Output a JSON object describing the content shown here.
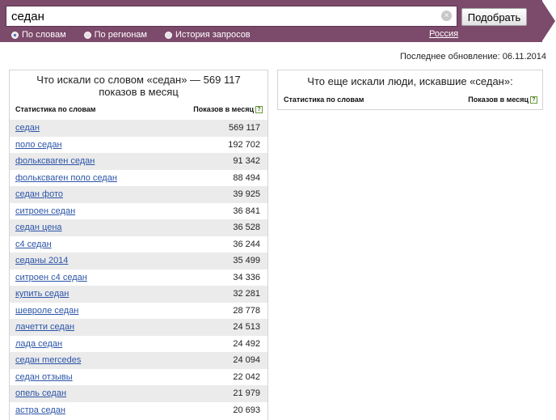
{
  "search": {
    "value": "седан",
    "button_label": "Подобрать"
  },
  "radios": [
    {
      "label": "По словам",
      "checked": true
    },
    {
      "label": "По регионам",
      "checked": false
    },
    {
      "label": "История запросов",
      "checked": false
    }
  ],
  "region": "Россия",
  "last_update": "Последнее обновление: 06.11.2014",
  "left_panel": {
    "title": "Что искали со словом «седан» — 569 117 показов в месяц",
    "col_stats": "Статистика по словам",
    "col_shows": "Показов в месяц",
    "help": "?",
    "rows": [
      {
        "keyword": "седан",
        "count": "569 117"
      },
      {
        "keyword": "поло седан",
        "count": "192 702"
      },
      {
        "keyword": "фольксваген седан",
        "count": "91 342"
      },
      {
        "keyword": "фольксваген поло седан",
        "count": "88 494"
      },
      {
        "keyword": "седан фото",
        "count": "39 925"
      },
      {
        "keyword": "ситроен седан",
        "count": "36 841"
      },
      {
        "keyword": "седан цена",
        "count": "36 528"
      },
      {
        "keyword": "с4 седан",
        "count": "36 244"
      },
      {
        "keyword": "седаны 2014",
        "count": "35 499"
      },
      {
        "keyword": "ситроен с4 седан",
        "count": "34 336"
      },
      {
        "keyword": "купить седан",
        "count": "32 281"
      },
      {
        "keyword": "шевроле седан",
        "count": "28 778"
      },
      {
        "keyword": "лачетти седан",
        "count": "24 513"
      },
      {
        "keyword": "лада седан",
        "count": "24 492"
      },
      {
        "keyword": "седан mercedes",
        "count": "24 094"
      },
      {
        "keyword": "седан отзывы",
        "count": "22 042"
      },
      {
        "keyword": "опель седан",
        "count": "21 979"
      },
      {
        "keyword": "астра седан",
        "count": "20 693"
      }
    ]
  },
  "right_panel": {
    "title": "Что еще искали люди, искавшие «седан»:",
    "col_stats": "Статистика по словам",
    "col_shows": "Показов в месяц",
    "help": "?"
  },
  "icons": {
    "clear": "clear-icon",
    "help": "help-icon"
  },
  "colors": {
    "band": "#7c4a6b",
    "link": "#2b54a8",
    "stripe": "#ebebeb"
  }
}
